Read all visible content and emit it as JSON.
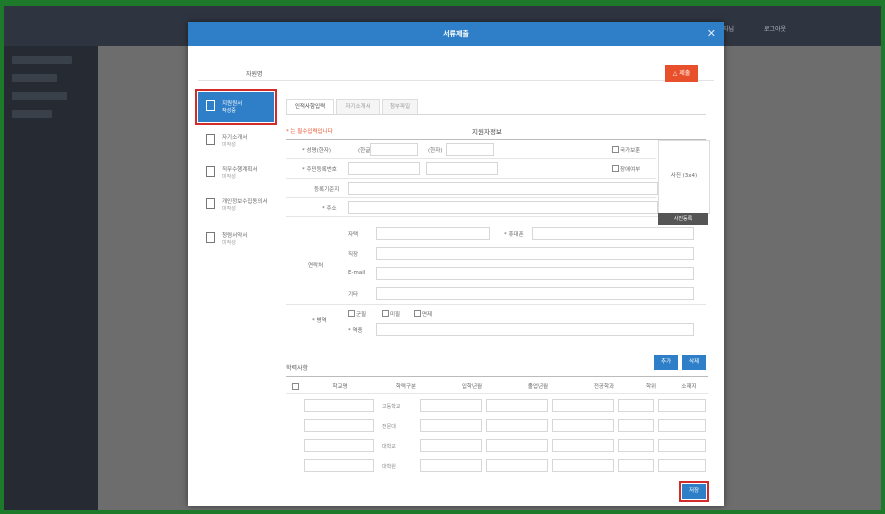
{
  "background": {
    "accent": "#2f7fc8",
    "frame_border": "#1c7a2a",
    "highlight": "#d12c2c"
  },
  "topbar": {
    "right_items": [
      "관리자님",
      "로그아웃"
    ]
  },
  "modal": {
    "title": "서류제출",
    "close_icon": "close-icon",
    "name_label": "자원명",
    "submit_label": "△ 제출",
    "save_label": "저장"
  },
  "stepper": {
    "items": [
      {
        "title": "지원원서",
        "sub": "작성중",
        "icon": "document-icon"
      },
      {
        "title": "자기소개서",
        "sub": "미작성",
        "icon": "edit-icon"
      },
      {
        "title": "직무수행계획서",
        "sub": "미작성",
        "icon": "document-icon"
      },
      {
        "title": "개인정보수집동의서",
        "sub": "미작성",
        "icon": "document-icon"
      },
      {
        "title": "청렴서약서",
        "sub": "미작성",
        "icon": "edit-icon"
      }
    ]
  },
  "tabs": [
    "인적사항입력",
    "자기소개서",
    "첨부파일"
  ],
  "form": {
    "required_note": "* 는 필수입력입니다",
    "section_title": "지원자정보",
    "name_label": "* 성명(한자)",
    "han_label": "(한글)",
    "hanja_label": "(한자)",
    "id_label": "* 주민등록번호",
    "reg_label": "등록기준지",
    "addr_label": "* 주소",
    "contact_label": "연락처",
    "home_label": "자택",
    "mobile_label": "* 휴대폰",
    "office_label": "직장",
    "email_label": "E-mail",
    "other_label": "기타",
    "military_label": "* 병역",
    "military_opts": [
      "군필",
      "미필",
      "면제"
    ],
    "military_sub": "* 역종",
    "check1": "국가보훈",
    "check2": "장애여부",
    "photo_label": "사진 (3x4)",
    "photo_btn": "사진등록"
  },
  "education": {
    "title": "학력사항",
    "add_label": "추가",
    "delete_label": "삭제",
    "headers": [
      "학교명",
      "학력구분",
      "입학년월",
      "졸업년월",
      "전공학과",
      "학위",
      "소재지"
    ],
    "row_values": [
      "고등학교",
      "전문대",
      "대학교",
      "대학원"
    ]
  }
}
